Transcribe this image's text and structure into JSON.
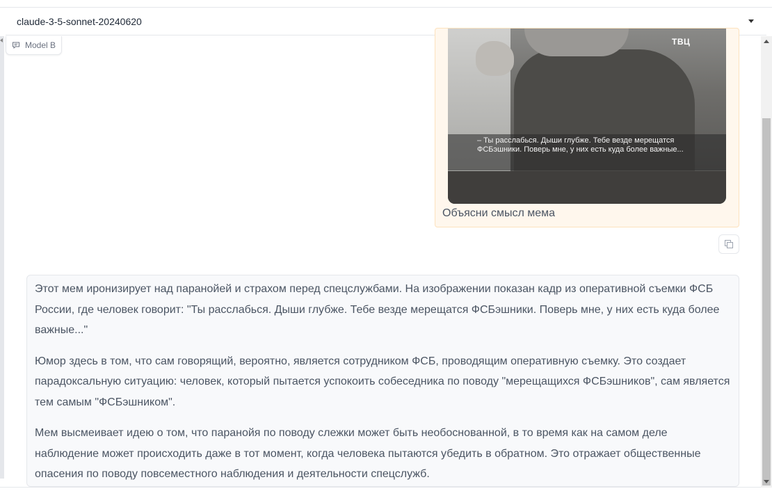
{
  "model_selector": {
    "value": "claude-3-5-sonnet-20240620"
  },
  "model_label": {
    "text": "Model B",
    "icon": "chat-bubble-icon"
  },
  "user_message": {
    "image": {
      "logo": "ТВЦ",
      "caption": "– Ты расслабься. Дыши глубже. Тебе везде мерещатся ФСБэшники. Поверь мне, у них есть куда более важные..."
    },
    "text": "Объясни смысл мема"
  },
  "copy_button": {
    "icon": "copy-icon"
  },
  "bot_message": {
    "paragraphs": [
      "Этот мем иронизирует над паранойей и страхом перед спецслужбами. На изображении показан кадр из оперативной съемки ФСБ России, где человек говорит: \"Ты расслабься. Дыши глубже. Тебе везде мерещатся ФСБэшники. Поверь мне, у них есть куда более важные...\"",
      "Юмор здесь в том, что сам говорящий, вероятно, является сотрудником ФСБ, проводящим оперативную съемку. Это создает парадоксальную ситуацию: человек, который пытается успокоить собеседника по поводу \"мерещащихся ФСБэшников\", сам является тем самым \"ФСБэшником\".",
      "Мем высмеивает идею о том, что паранойя по поводу слежки может быть необоснованной, в то время как на самом деле наблюдение может происходить даже в тот момент, когда человека пытаются убедить в обратном. Это отражает общественные опасения по поводу повсеместного наблюдения и деятельности спецслужб."
    ]
  },
  "colors": {
    "user_bubble": "#fff7ed",
    "bot_bubble": "#f8f9fb",
    "text": "#4b5563"
  }
}
